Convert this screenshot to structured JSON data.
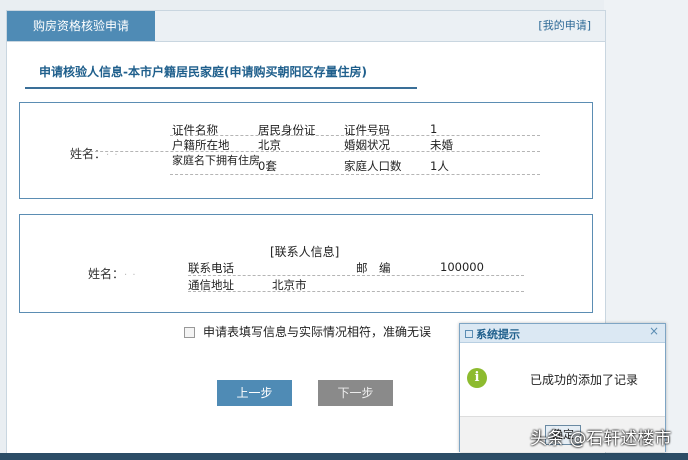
{
  "header": {
    "active_tab": "购房资格核验申请",
    "my_applications": "[我的申请]"
  },
  "section": {
    "title": "申请核验人信息-本市户籍居民家庭(申请购买朝阳区存量住房)"
  },
  "person": {
    "name_label": "姓名：",
    "fields": [
      [
        {
          "label": "证件名称",
          "value": "居民身份证"
        },
        {
          "label": "证件号码",
          "value": "1"
        }
      ],
      [
        {
          "label": "户籍所在地",
          "value": "北京"
        },
        {
          "label": "婚姻状况",
          "value": "未婚"
        }
      ],
      [
        {
          "label": "家庭名下拥有住房",
          "value": "0套"
        },
        {
          "label": "家庭人口数",
          "value": "1人"
        }
      ]
    ]
  },
  "contact": {
    "title": "[联系人信息]",
    "name_label": "姓名：",
    "phone_label": "联系电话",
    "postcode_label": "邮　编",
    "postcode_value": "100000",
    "address_label": "通信地址",
    "address_value": "北京市"
  },
  "confirm": {
    "label": "申请表填写信息与实际情况相符，准确无误"
  },
  "buttons": {
    "prev": "上一步",
    "next": "下一步"
  },
  "dialog": {
    "title": "系统提示",
    "message": "已成功的添加了记录",
    "ok": "确定",
    "close": "×"
  },
  "watermark": "头条 @石轩述楼市"
}
